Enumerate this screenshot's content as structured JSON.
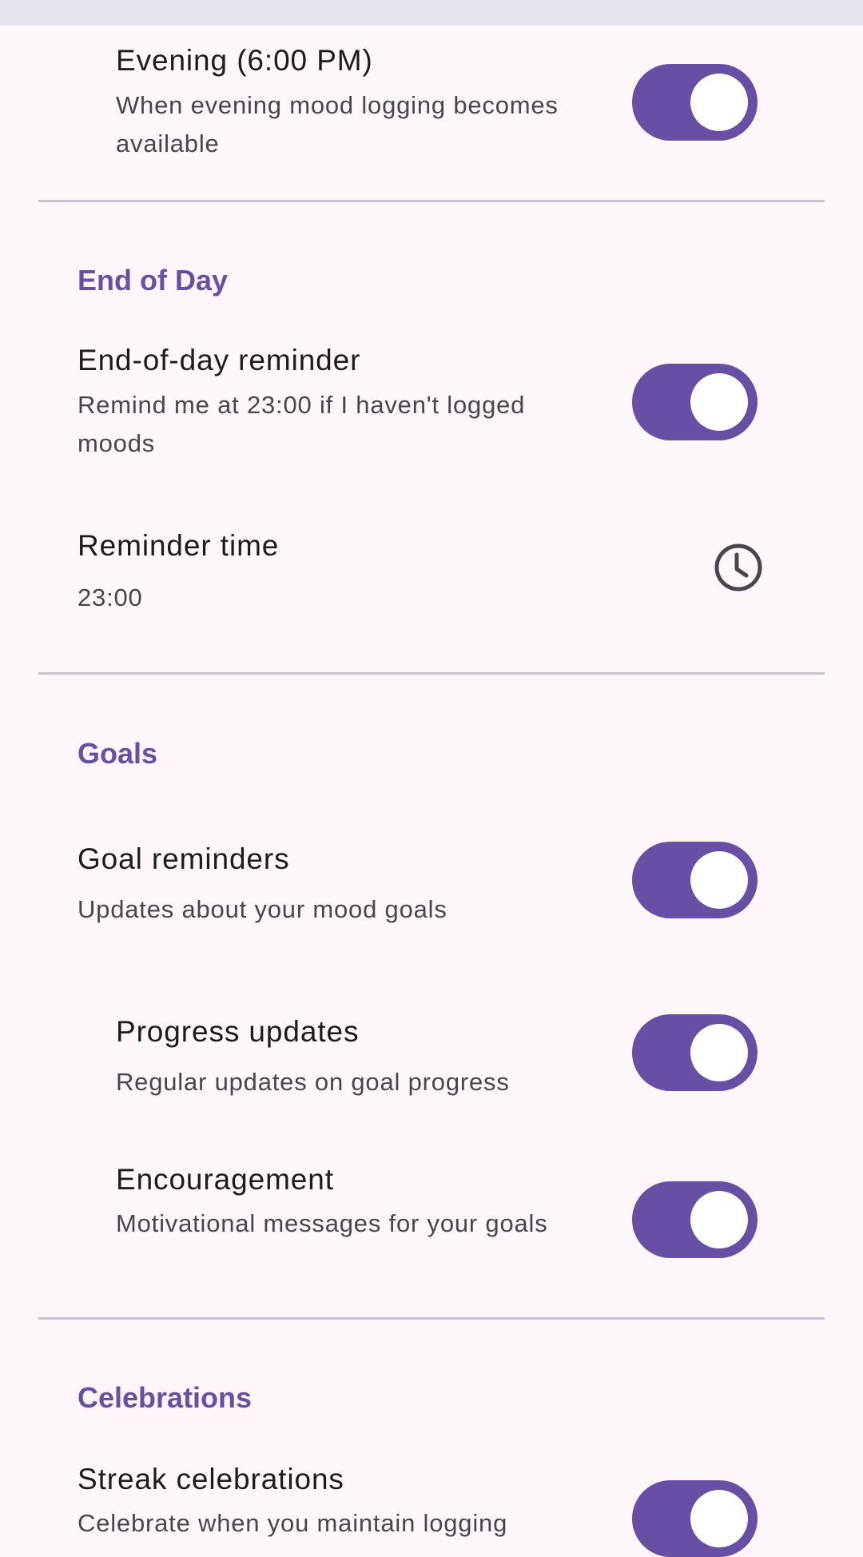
{
  "items": {
    "evening": {
      "title": "Evening (6:00 PM)",
      "subtitle": "When evening mood logging becomes available",
      "enabled": true
    },
    "end_of_day_reminder": {
      "title": "End-of-day reminder",
      "subtitle": "Remind me at 23:00 if I haven't logged moods",
      "enabled": true
    },
    "reminder_time": {
      "title": "Reminder time",
      "value": "23:00",
      "icon": "clock-icon"
    },
    "goal_reminders": {
      "title": "Goal reminders",
      "subtitle": "Updates about your mood goals",
      "enabled": true
    },
    "progress_updates": {
      "title": "Progress updates",
      "subtitle": "Regular updates on goal progress",
      "enabled": true
    },
    "encouragement": {
      "title": "Encouragement",
      "subtitle": "Motivational messages for your goals",
      "enabled": true
    },
    "streak_celebrations": {
      "title": "Streak celebrations",
      "subtitle": "Celebrate when you maintain logging",
      "enabled": true
    }
  },
  "sections": {
    "end_of_day": "End of Day",
    "goals": "Goals",
    "celebrations": "Celebrations"
  },
  "colors": {
    "accent": "#6750a4",
    "background": "#fdf7fc",
    "divider": "#cac4d0",
    "text_primary": "#1d1b20",
    "text_secondary": "#49454f"
  }
}
